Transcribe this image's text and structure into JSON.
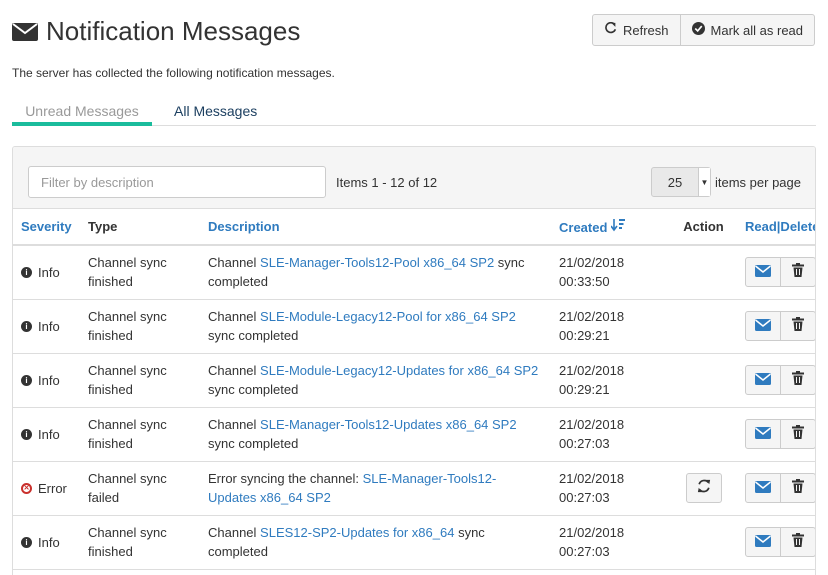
{
  "page": {
    "title": "Notification Messages",
    "intro": "The server has collected the following notification messages."
  },
  "toolbar": {
    "refresh_label": "Refresh",
    "mark_all_label": "Mark all as read"
  },
  "tabs": [
    {
      "label": "Unread Messages",
      "active": true
    },
    {
      "label": "All Messages",
      "active": false
    }
  ],
  "filter": {
    "placeholder": "Filter by description",
    "value": ""
  },
  "pagination": {
    "items_text": "Items 1 - 12 of 12",
    "page_size": "25",
    "page_size_label": "items per page"
  },
  "table": {
    "headers": {
      "severity": "Severity",
      "type": "Type",
      "description": "Description",
      "created": "Created",
      "action": "Action",
      "read_delete": "Read|Delete"
    },
    "rows": [
      {
        "severity": "Info",
        "type": "Channel sync finished",
        "desc_prefix": "Channel ",
        "desc_link": "SLE-Manager-Tools12-Pool x86_64 SP2",
        "desc_suffix": " sync completed",
        "created_date": "21/02/2018",
        "created_time": "00:33:50",
        "has_action": false
      },
      {
        "severity": "Info",
        "type": "Channel sync finished",
        "desc_prefix": "Channel ",
        "desc_link": "SLE-Module-Legacy12-Pool for x86_64 SP2",
        "desc_suffix": " sync completed",
        "created_date": "21/02/2018",
        "created_time": "00:29:21",
        "has_action": false
      },
      {
        "severity": "Info",
        "type": "Channel sync finished",
        "desc_prefix": "Channel ",
        "desc_link": "SLE-Module-Legacy12-Updates for x86_64 SP2",
        "desc_suffix": " sync completed",
        "created_date": "21/02/2018",
        "created_time": "00:29:21",
        "has_action": false
      },
      {
        "severity": "Info",
        "type": "Channel sync finished",
        "desc_prefix": "Channel ",
        "desc_link": "SLE-Manager-Tools12-Updates x86_64 SP2",
        "desc_suffix": " sync completed",
        "created_date": "21/02/2018",
        "created_time": "00:27:03",
        "has_action": false
      },
      {
        "severity": "Error",
        "type": "Channel sync failed",
        "desc_prefix": "Error syncing the channel: ",
        "desc_link": "SLE-Manager-Tools12-Updates x86_64 SP2",
        "desc_suffix": "",
        "created_date": "21/02/2018",
        "created_time": "00:27:03",
        "has_action": true
      },
      {
        "severity": "Info",
        "type": "Channel sync finished",
        "desc_prefix": "Channel ",
        "desc_link": "SLES12-SP2-Updates for x86_64",
        "desc_suffix": " sync completed",
        "created_date": "21/02/2018",
        "created_time": "00:27:03",
        "has_action": false
      }
    ]
  },
  "icons": {
    "envelope": "envelope-icon",
    "refresh": "refresh-icon",
    "check": "check-circle-icon",
    "sort": "sort-desc-icon",
    "info": "info-icon",
    "error": "error-icon",
    "mail": "mail-icon",
    "trash": "trash-icon",
    "resync": "resync-icon"
  },
  "colors": {
    "link": "#2f7bbf",
    "active_tab": "#1abc9c",
    "error": "#c9302c"
  }
}
